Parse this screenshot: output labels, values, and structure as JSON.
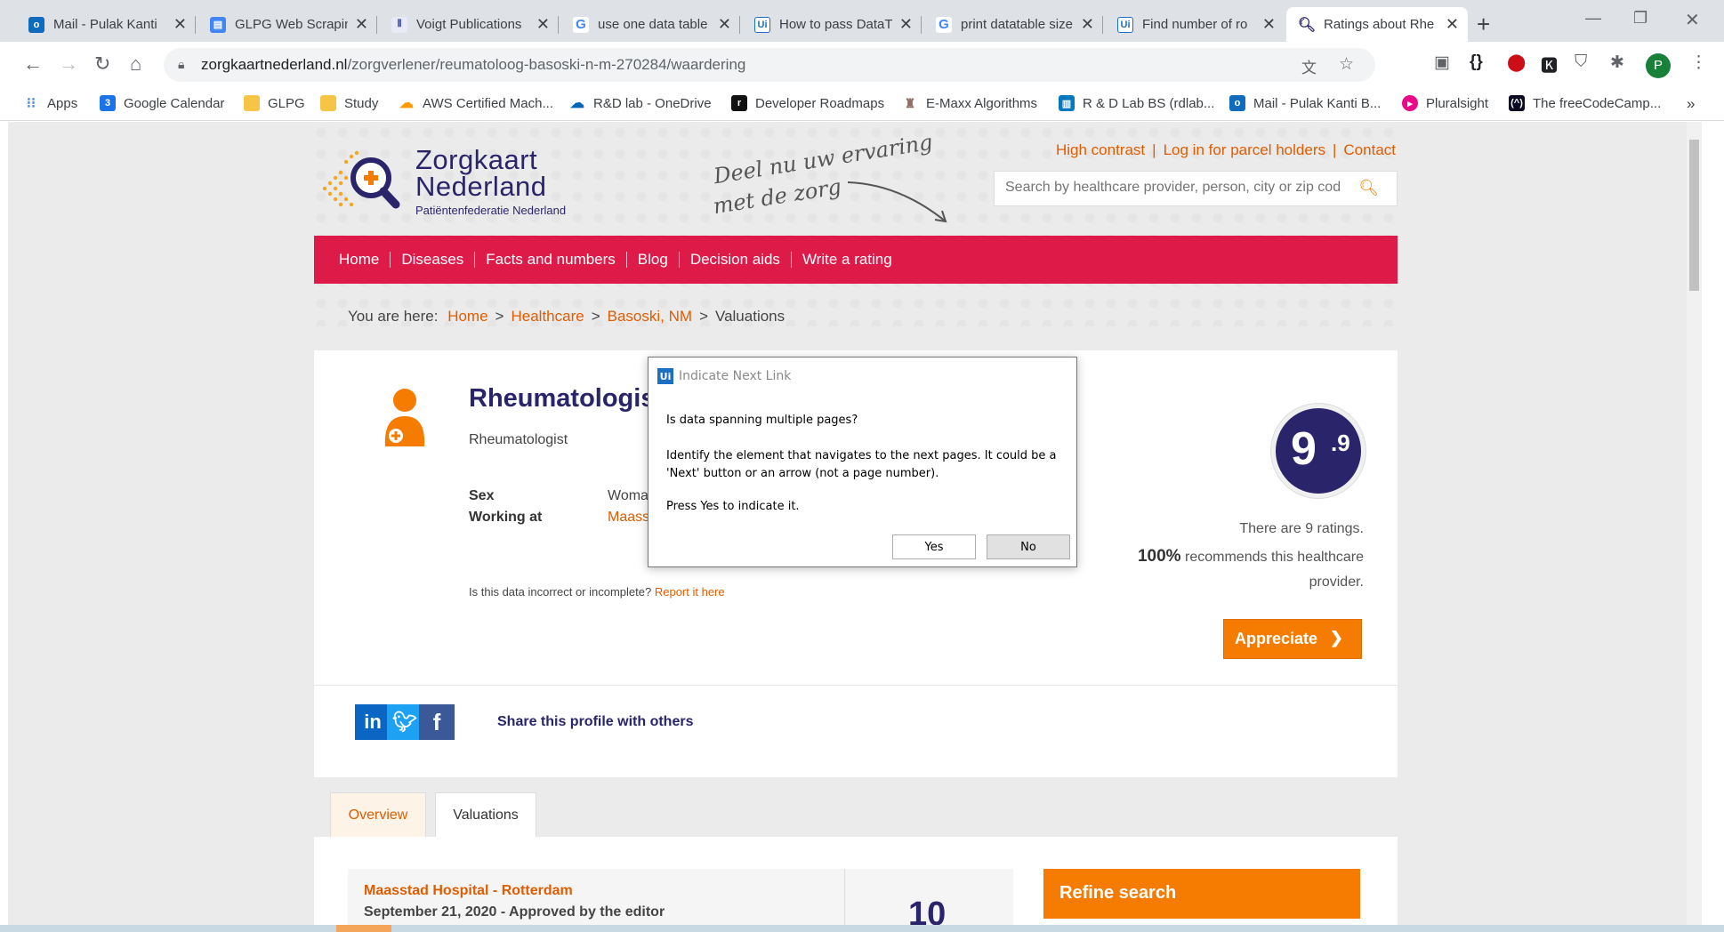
{
  "browser": {
    "tabs": [
      {
        "title": "Mail - Pulak Kanti",
        "icon": "outlook-icon",
        "color": "#0f6cbd"
      },
      {
        "title": "GLPG Web Scrapin",
        "icon": "docs-icon",
        "color": "#4285f4"
      },
      {
        "title": "Voigt Publications",
        "icon": "site-icon",
        "color": "#3f51b5"
      },
      {
        "title": "use one data table",
        "icon": "google-icon",
        "color": "#4285f4"
      },
      {
        "title": "How to pass DataT",
        "icon": "uipath-icon",
        "color": "#1d6fc4"
      },
      {
        "title": "print datatable size",
        "icon": "google-icon",
        "color": "#4285f4"
      },
      {
        "title": "Find number of ro",
        "icon": "uipath-icon",
        "color": "#1d6fc4"
      },
      {
        "title": "Ratings about Rhe",
        "icon": "search-favicon",
        "color": "#2a246a"
      }
    ],
    "url_domain": "zorgkaartnederland.nl",
    "url_path": "/zorgverlener/reumatoloog-basoski-n-m-270284/waardering",
    "profile_initial": "P",
    "bookmarks": [
      {
        "label": "Apps"
      },
      {
        "label": "Google Calendar"
      },
      {
        "label": "GLPG"
      },
      {
        "label": "Study"
      },
      {
        "label": "AWS Certified Mach..."
      },
      {
        "label": "R&D lab - OneDrive"
      },
      {
        "label": "Developer Roadmaps"
      },
      {
        "label": "E-Maxx Algorithms"
      },
      {
        "label": "R & D Lab BS (rdlab..."
      },
      {
        "label": "Mail - Pulak Kanti B..."
      },
      {
        "label": "Pluralsight"
      },
      {
        "label": "The freeCodeCamp..."
      }
    ],
    "overflow": "»"
  },
  "site": {
    "logo": {
      "line1": "Zorgkaart",
      "line2": "Nederland",
      "line3": "Patiëntenfederatie Nederland"
    },
    "tagline": {
      "line1": "Deel nu uw ervaring",
      "line2": "met de zorg"
    },
    "toplinks": [
      "High contrast",
      "Log in for parcel holders",
      "Contact"
    ],
    "search_placeholder": "Search by healthcare provider, person, city or zip cod",
    "nav": [
      "Home",
      "Diseases",
      "Facts and numbers",
      "Blog",
      "Decision aids",
      "Write a rating"
    ],
    "breadcrumb": {
      "prefix": "You are here:",
      "items": [
        "Home",
        "Healthcare",
        "Basoski, NM"
      ],
      "current": "Valuations"
    }
  },
  "provider": {
    "title": "Rheumatologist",
    "subtitle": "Rheumatologist",
    "sex_label": "Sex",
    "sex_value": "Woman",
    "working_label": "Working at",
    "working_value": "Maasst",
    "report_text": "Is this data incorrect or incomplete?",
    "report_link": "Report it here",
    "score_int": "9",
    "score_dec": ".9",
    "ratings_text": "There are 9 ratings.",
    "recommend_pct": "100%",
    "recommend_text": "recommends this healthcare provider.",
    "appreciate_label": "Appreciate",
    "share_text": "Share this profile with others"
  },
  "tabs": {
    "overview": "Overview",
    "valuations": "Valuations"
  },
  "review": {
    "hospital": "Maasstad Hospital - Rotterdam",
    "date": "September 21, 2020 - Approved by the editor",
    "score": "10"
  },
  "refine_label": "Refine search",
  "dialog": {
    "title": "Indicate Next Link",
    "question": "Is data spanning multiple pages?",
    "body": "Identify the element that navigates to the next pages. It could be a 'Next' button or an arrow (not a page number).",
    "press": "Press Yes to indicate it.",
    "yes": "Yes",
    "no": "No"
  },
  "colors": {
    "brand_red": "#dd1a48",
    "brand_orange": "#f57c00",
    "brand_navy": "#2a246a"
  }
}
